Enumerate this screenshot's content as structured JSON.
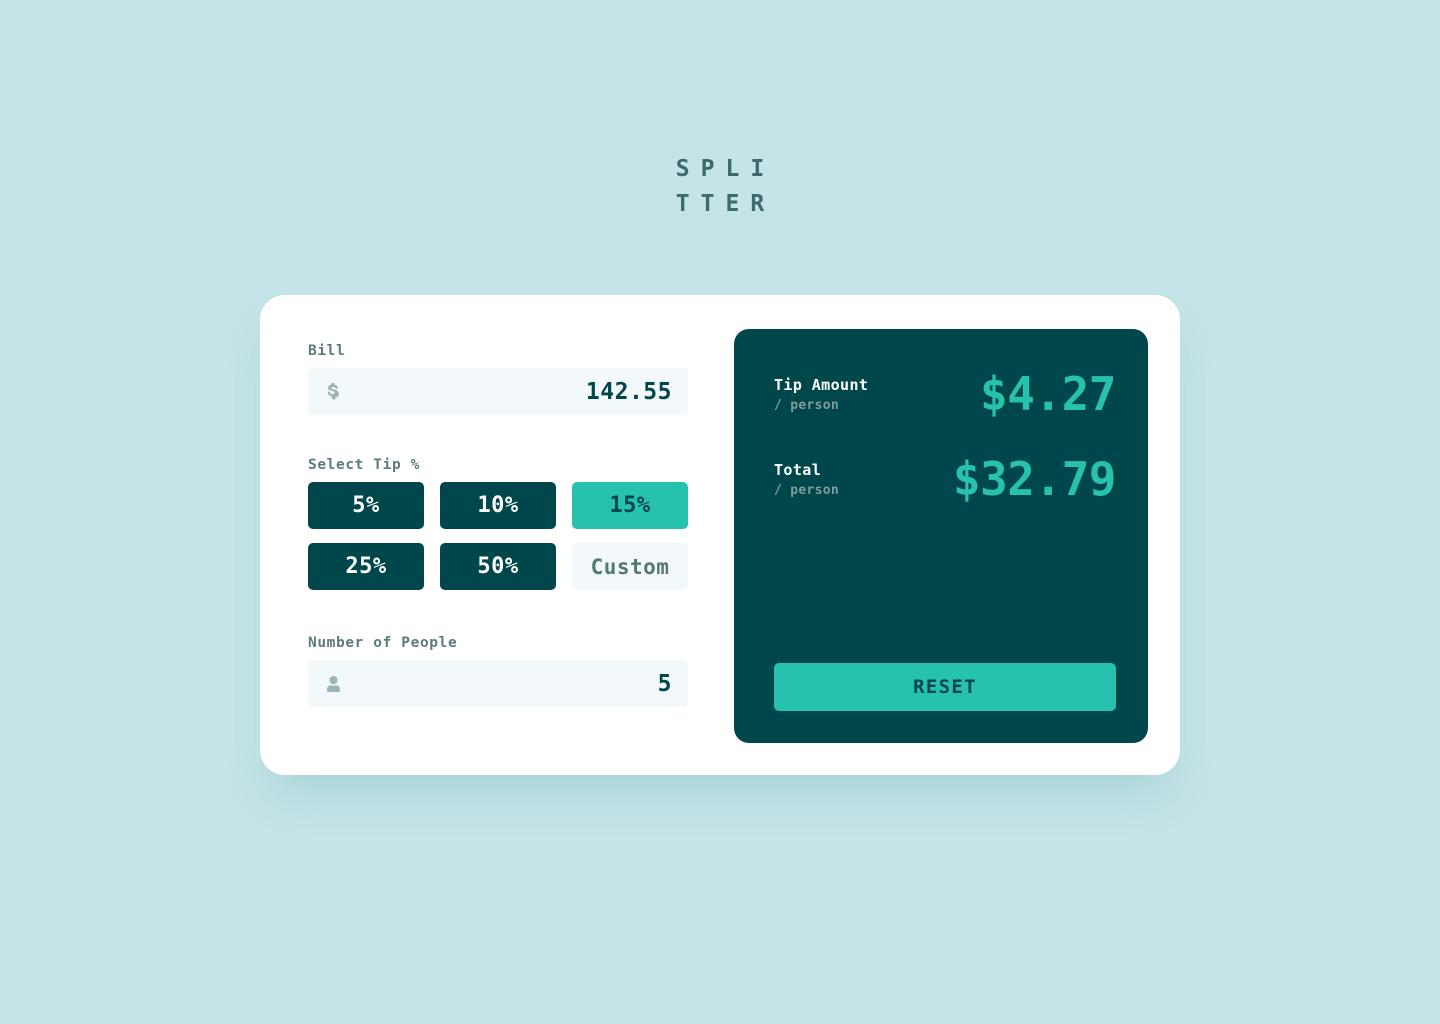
{
  "logo": {
    "line1": "SPLI",
    "line2": "TTER"
  },
  "colors": {
    "background": "#c5e4e7",
    "card": "#ffffff",
    "dark_teal": "#00474b",
    "accent": "#26c2ae",
    "input_bg": "#f3f8fb",
    "label": "#5e7a7d",
    "muted": "#7f9c9f"
  },
  "bill": {
    "label": "Bill",
    "icon": "dollar-icon",
    "value": "142.55",
    "placeholder": "0"
  },
  "tip": {
    "label": "Select Tip %",
    "options": [
      {
        "label": "5%",
        "selected": false
      },
      {
        "label": "10%",
        "selected": false
      },
      {
        "label": "15%",
        "selected": true
      },
      {
        "label": "25%",
        "selected": false
      },
      {
        "label": "50%",
        "selected": false
      },
      {
        "label": "Custom",
        "selected": false
      }
    ]
  },
  "people": {
    "label": "Number of People",
    "icon": "person-icon",
    "value": "5",
    "placeholder": "0"
  },
  "results": {
    "rows": [
      {
        "title": "Tip Amount",
        "subtitle": "/ person",
        "value": "$4.27"
      },
      {
        "title": "Total",
        "subtitle": "/ person",
        "value": "$32.79"
      }
    ],
    "reset_label": "RESET"
  }
}
